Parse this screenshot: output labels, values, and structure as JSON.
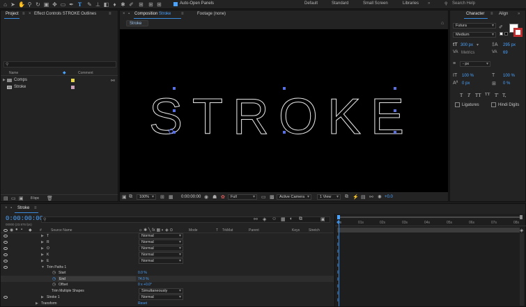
{
  "toolbar": {
    "auto_open_label": "Auto-Open Panels",
    "workspaces": [
      "Default",
      "Standard",
      "Small Screen",
      "Libraries"
    ],
    "search_placeholder": "Search Help"
  },
  "project_panel": {
    "tab_project": "Project",
    "tab_effect_controls": "Effect Controls STROKE Outlines",
    "col_name": "Name",
    "col_comment": "Comment",
    "items": [
      {
        "label": "Comps",
        "color": "#e6d44a"
      },
      {
        "label": "Stroke",
        "color": "#c9a0b8"
      }
    ],
    "bpc": "8 bpc"
  },
  "comp_panel": {
    "tab_prefix": "Composition",
    "tab_name": "Stroke",
    "tab_footage": "Footage (none)",
    "breadcrumb": "Stroke",
    "canvas_text": "STROKE",
    "zoom": "100%",
    "timecode": "0:00:00:00",
    "resolution": "Full",
    "camera": "Active Camera",
    "view": "1 View",
    "exposure": "+0.0"
  },
  "character_panel": {
    "tab_character": "Character",
    "tab_align": "Align",
    "font_family": "Futura",
    "font_style": "Medium",
    "font_size": "300 px",
    "leading": "295 px",
    "kerning": "Metrics",
    "tracking": "69",
    "stroke_width": "- px",
    "vertical_scale": "100 %",
    "horizontal_scale": "100 %",
    "baseline_shift": "0 px",
    "tsume": "0 %",
    "style_buttons": [
      "T",
      "T",
      "TT",
      "TT",
      "T'",
      "T,"
    ],
    "ligatures_label": "Ligatures",
    "hindi_digits_label": "Hindi Digits",
    "fill_color": "#ffffff",
    "stroke_color": "#c03030"
  },
  "timeline": {
    "tab_name": "Stroke",
    "timecode": "0:00:00:00",
    "frame_info": "00000 (23.976 fps)",
    "col_source_name": "Source Name",
    "col_mode": "Mode",
    "col_t": "T",
    "col_trkmat": "TrkMat",
    "col_parent": "Parent",
    "col_keys": "Keys",
    "col_stretch": "Stretch",
    "ruler": [
      "0s",
      "01s",
      "02s",
      "03s",
      "04s",
      "05s",
      "06s",
      "07s",
      "08s"
    ],
    "layers": [
      {
        "name": "T",
        "mode": "Normal"
      },
      {
        "name": "R",
        "mode": "Normal"
      },
      {
        "name": "O",
        "mode": "Normal"
      },
      {
        "name": "K",
        "mode": "Normal"
      },
      {
        "name": "E",
        "mode": "Normal"
      }
    ],
    "trim_paths": "Trim Paths 1",
    "start_label": "Start",
    "start_value": "0.0 %",
    "end_label": "End",
    "end_value": "74.0 %",
    "offset_label": "Offset",
    "offset_value": "0 x +0.0°",
    "trim_multiple_label": "Trim Multiple Shapes",
    "trim_multiple_value": "Simultaneously",
    "stroke_label": "Stroke 1",
    "stroke_mode": "Normal",
    "transform_label": "Transform",
    "reset_label": "Reset"
  }
}
